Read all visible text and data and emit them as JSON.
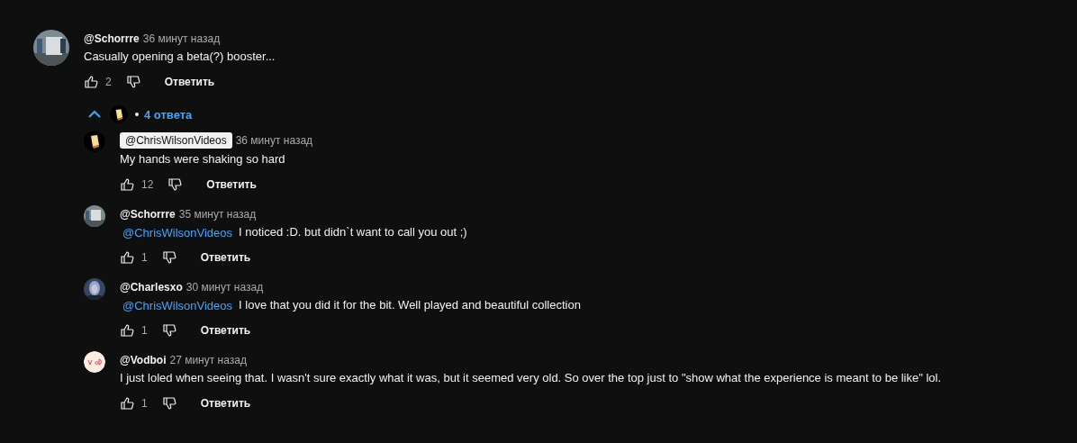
{
  "comment": {
    "author": "@Schorrre",
    "time": "36 минут назад",
    "text": "Casually opening a beta(?) booster...",
    "likes": "2",
    "reply": "Ответить"
  },
  "replies_toggle": {
    "expanded": true,
    "avatar": {
      "kind": "logo"
    },
    "label": "4 ответа"
  },
  "replies": [
    {
      "avatar": {
        "kind": "logo"
      },
      "author": "@ChrisWilsonVideos",
      "author_highlighted": true,
      "time": "36 минут назад",
      "text": "My hands were shaking so hard",
      "likes": "12",
      "reply": "Ответить"
    },
    {
      "author": "@Schorrre",
      "author_highlighted": false,
      "time": "35 минут назад",
      "mention": "@ChrisWilsonVideos",
      "text": "I noticed :D. but didn`t want to call you out ;)",
      "likes": "1",
      "reply": "Ответить"
    },
    {
      "avatar": {
        "kind": "portrait"
      },
      "author": "@Charlesxo",
      "author_highlighted": false,
      "time": "30 минут назад",
      "mention": "@ChrisWilsonVideos",
      "text": "I love that you did it for the bit. Well played and beautiful collection",
      "likes": "1",
      "reply": "Ответить"
    },
    {
      "avatar": {
        "kind": "doodle"
      },
      "author": "@Vodboi",
      "author_highlighted": false,
      "time": "27 минут назад",
      "text": "I just loled when seeing that. I wasn't sure exactly what it was, but it seemed very old. So over the top just to \"show what the experience is meant to be like\" lol.",
      "likes": "1",
      "reply": "Ответить"
    }
  ]
}
